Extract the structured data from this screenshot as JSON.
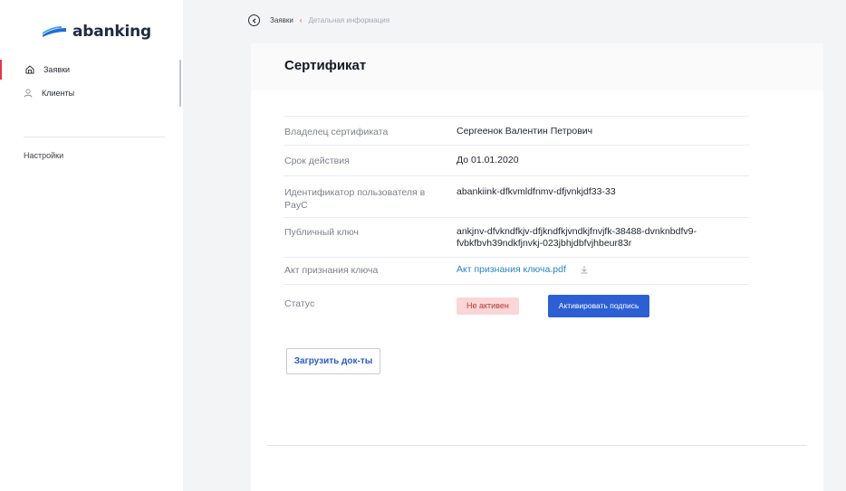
{
  "app": {
    "logo_text": "abanking",
    "brand_color": "#1f6fd6",
    "accent_color": "#e2364a"
  },
  "sidebar": {
    "items": [
      {
        "label": "Заявки",
        "icon": "home-icon",
        "active": true
      },
      {
        "label": "Клиенты",
        "icon": "user-icon",
        "active": false
      }
    ],
    "settings_label": "Настройки"
  },
  "breadcrumb": {
    "back_icon": "back-circle-icon",
    "parent": "Заявки",
    "separator": "‹",
    "current": "Детальная информация"
  },
  "card": {
    "title": "Сертификат",
    "rows": [
      {
        "label": "Владелец сертификата",
        "value": "Сергеенок Валентин Петрович"
      },
      {
        "label": "Срок действия",
        "value": "До 01.01.2020"
      },
      {
        "label": "Идентификатор пользователя в PayC",
        "value": "abankiink-dfkvmldfnmv-dfjvnkjdf33-33"
      },
      {
        "label": "Публичный ключ",
        "value": "ankjnv-dfvkndfkjv-dfjkndfkjvndkjfnvjfk-38488-dvnknbdfv9-fvbkfbvh39ndkfjnvkj-023jbhjdbfvjhbeur83r"
      },
      {
        "label": "Акт признания ключа",
        "value": "Акт признания ключа.pdf",
        "icon": "download-icon"
      },
      {
        "label": "Статус",
        "badge": "Не активен",
        "button": "Активировать подпись"
      }
    ],
    "upload_button": "Загрузить док-ты"
  }
}
